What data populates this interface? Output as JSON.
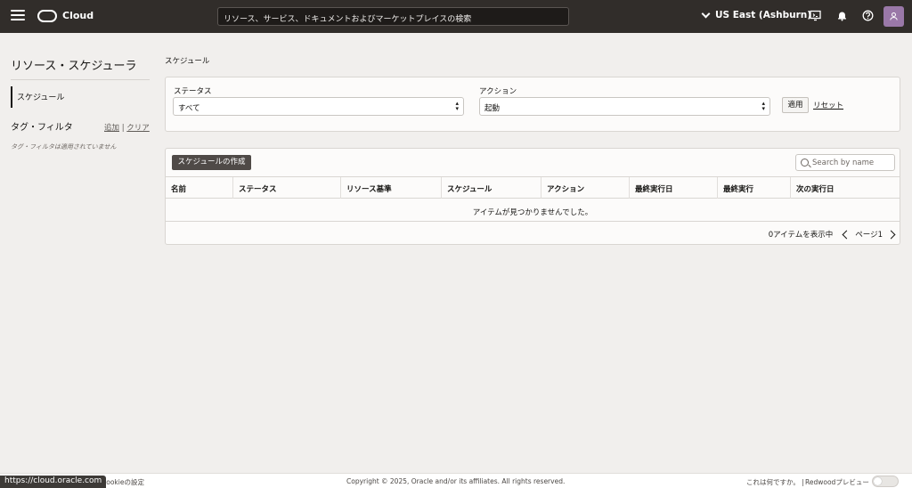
{
  "header": {
    "brand": "Cloud",
    "search_placeholder": "リソース、サービス、ドキュメントおよびマーケットプレイスの検索",
    "region": "US East (Ashburn)"
  },
  "sidebar": {
    "title": "リソース・スケジューラ",
    "items": [
      {
        "label": "スケジュール"
      }
    ],
    "tag_filter_title": "タグ・フィルタ",
    "add_label": "追加",
    "clear_label": "クリア",
    "separator": "|",
    "no_filter_note": "タグ・フィルタは適用されていません"
  },
  "main": {
    "breadcrumb": "スケジュール",
    "filters": {
      "status_label": "ステータス",
      "status_value": "すべて",
      "action_label": "アクション",
      "action_value": "起動",
      "apply_label": "適用",
      "reset_label": "リセット"
    },
    "table": {
      "create_button": "スケジュールの作成",
      "search_placeholder": "Search by name",
      "columns": [
        "名前",
        "ステータス",
        "リソース基準",
        "スケジュール",
        "アクション",
        "最終実行日",
        "最終実行",
        "次の実行日"
      ],
      "empty_message": "アイテムが見つかりませんでした。",
      "item_count": "0アイテムを表示中",
      "page_label": "ページ1"
    }
  },
  "footer": {
    "url_tooltip": "https://cloud.oracle.com",
    "cookie": "Cookieの設定",
    "copyright": "Copyright © 2025, Oracle and/or its affiliates. All rights reserved.",
    "help": "これは何ですか。 |",
    "redwood": "Redwoodプレビュー"
  }
}
